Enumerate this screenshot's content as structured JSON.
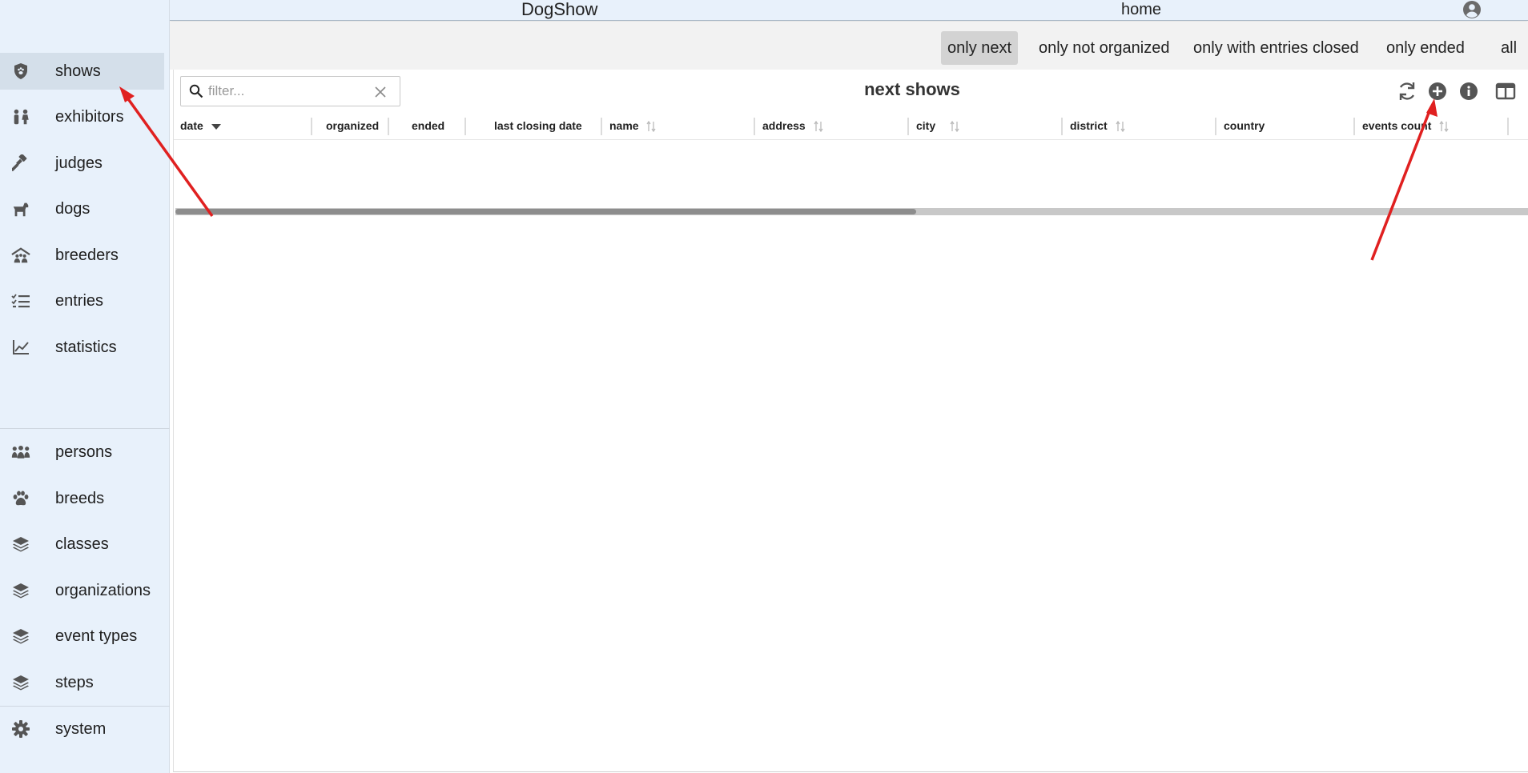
{
  "app": {
    "title": "DogShow",
    "home_label": "home"
  },
  "sidebar": {
    "primary_items": [
      {
        "label": "shows",
        "icon": "shield-paw-icon",
        "active": true
      },
      {
        "label": "exhibitors",
        "icon": "people-icon"
      },
      {
        "label": "judges",
        "icon": "gavel-icon"
      },
      {
        "label": "dogs",
        "icon": "dog-icon"
      },
      {
        "label": "breeders",
        "icon": "house-people-icon"
      },
      {
        "label": "entries",
        "icon": "checklist-icon"
      },
      {
        "label": "statistics",
        "icon": "line-chart-icon"
      }
    ],
    "secondary_items": [
      {
        "label": "persons",
        "icon": "group-icon"
      },
      {
        "label": "breeds",
        "icon": "paw-icon"
      },
      {
        "label": "classes",
        "icon": "layers-icon"
      },
      {
        "label": "organizations",
        "icon": "layers-icon"
      },
      {
        "label": "event types",
        "icon": "layers-icon"
      },
      {
        "label": "steps",
        "icon": "layers-icon"
      }
    ],
    "system_item": {
      "label": "system",
      "icon": "gear-icon"
    }
  },
  "filters": [
    {
      "label": "only next",
      "active": true
    },
    {
      "label": "only not organized"
    },
    {
      "label": "only with entries closed"
    },
    {
      "label": "only ended"
    },
    {
      "label": "all"
    }
  ],
  "grid": {
    "title": "next shows",
    "search_placeholder": "filter...",
    "toolbar_icons": [
      "refresh-icon",
      "add-circle-icon",
      "info-icon",
      "columns-icon"
    ],
    "columns": [
      {
        "label": "date",
        "sort": "desc"
      },
      {
        "label": "organized"
      },
      {
        "label": "ended"
      },
      {
        "label": "last closing date"
      },
      {
        "label": "name",
        "sort": "none"
      },
      {
        "label": "address",
        "sort": "none"
      },
      {
        "label": "city",
        "sort": "none"
      },
      {
        "label": "district",
        "sort": "none"
      },
      {
        "label": "country"
      },
      {
        "label": "events count",
        "sort": "none"
      }
    ],
    "rows": []
  },
  "colors": {
    "sidebar_bg": "#e8f1fb",
    "active_item_bg": "#d4dfea",
    "filter_bar_bg": "#f2f2f2",
    "annotation_arrow": "#e02020"
  }
}
